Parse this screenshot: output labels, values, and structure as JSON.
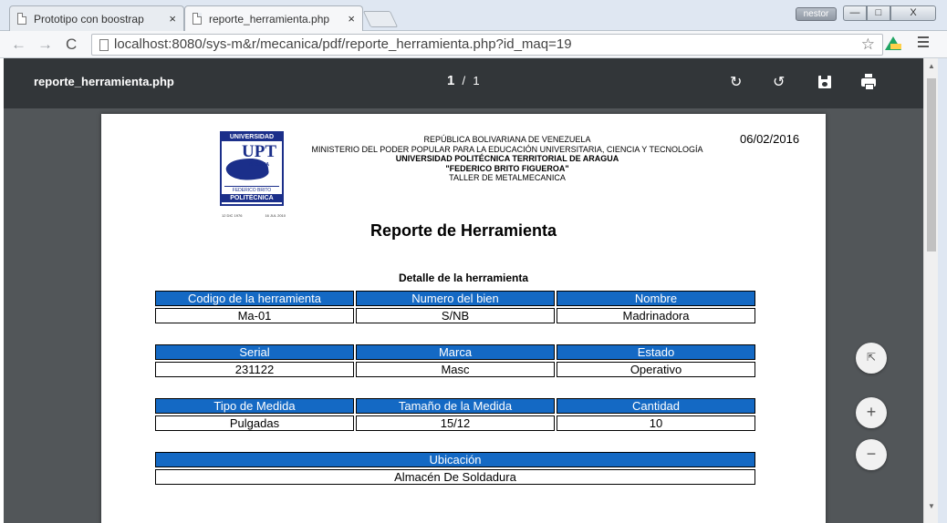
{
  "browser": {
    "tabs": [
      {
        "label": "Prototipo con boostrap",
        "active": false
      },
      {
        "label": "reporte_herramienta.php",
        "active": true
      }
    ],
    "user_badge": "nestor",
    "window_controls": {
      "minimize": "—",
      "maximize": "□",
      "close": "X"
    },
    "url": "localhost:8080/sys-m&r/mecanica/pdf/reporte_herramienta.php?id_maq=19",
    "icons": {
      "back": "←",
      "forward": "→",
      "reload": "C",
      "star": "☆"
    }
  },
  "viewer": {
    "title": "reporte_herramienta.php",
    "page_current": "1",
    "page_separator": "/",
    "page_total": "1",
    "icons": {
      "rotate_cw": "↻",
      "rotate_ccw": "↺"
    },
    "fabs": {
      "fit": "⇱",
      "zoom_in": "+",
      "zoom_out": "−"
    }
  },
  "document": {
    "logo": {
      "top": "UNIVERSIDAD",
      "acronym": "UPT",
      "region": "ARAGUA",
      "banner": "FEDERICO BRITO FIGUEROA",
      "bottom": "POLITÉCNICA",
      "date_left": "12 DIC 1976",
      "date_right": "16 JUL 2010"
    },
    "header_lines": [
      "REPÚBLICA BOLIVARIANA DE VENEZUELA",
      "MINISTERIO DEL PODER POPULAR PARA LA EDUCACIÓN UNIVERSITARIA, CIENCIA Y TECNOLOGÍA",
      "UNIVERSIDAD POLITÉCNICA TERRITORIAL DE ARAGUA",
      "\"FEDERICO BRITO FIGUEROA\"",
      "TALLER DE METALMECANICA"
    ],
    "date": "06/02/2016",
    "title": "Reporte de Herramienta",
    "section": "Detalle de la herramienta",
    "table1": {
      "headers": [
        "Codigo de la herramienta",
        "Numero del bien",
        "Nombre"
      ],
      "values": [
        "Ma-01",
        "S/NB",
        "Madrinadora"
      ]
    },
    "table2": {
      "headers": [
        "Serial",
        "Marca",
        "Estado"
      ],
      "values": [
        "231122",
        "Masc",
        "Operativo"
      ]
    },
    "table3": {
      "headers": [
        "Tipo de Medida",
        "Tamaño de la Medida",
        "Cantidad"
      ],
      "values": [
        "Pulgadas",
        "15/12",
        "10"
      ]
    },
    "table4": {
      "headers": [
        "Ubicación"
      ],
      "values": [
        "Almacén De Soldadura"
      ]
    }
  },
  "colors": {
    "table_header": "#1469c4",
    "viewer_bar": "#323639",
    "viewer_bg": "#525659"
  }
}
